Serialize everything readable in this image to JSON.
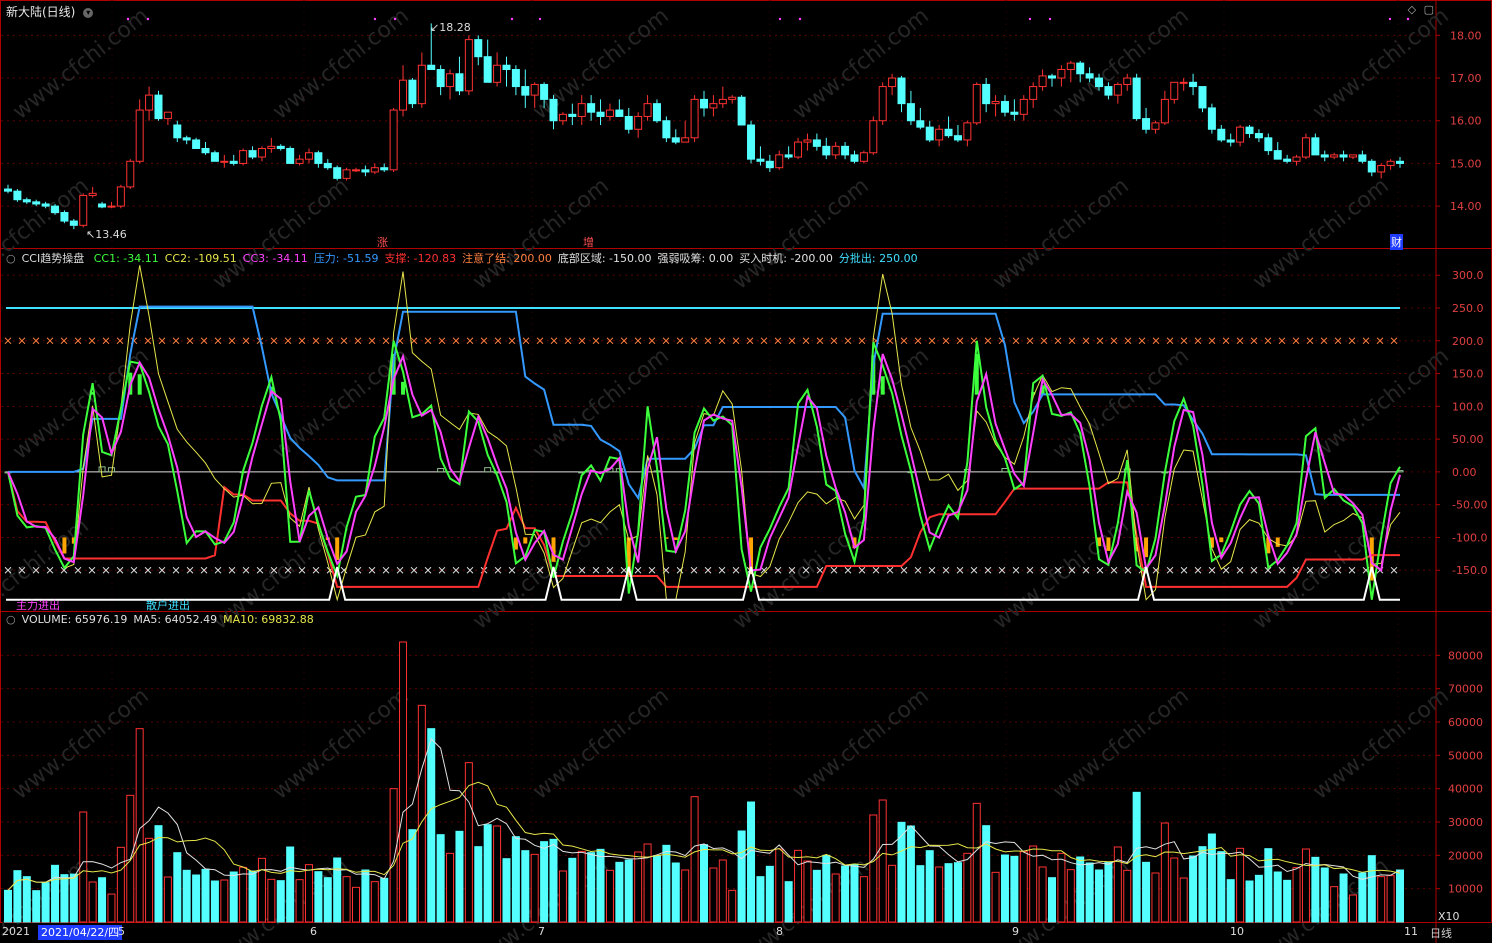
{
  "window": {
    "title": "新大陆(日线)",
    "corner_icons": [
      "diamond-icon",
      "window-icon"
    ]
  },
  "price_panel": {
    "y_ticks": [
      "18.00",
      "17.00",
      "16.00",
      "15.00",
      "14.00"
    ],
    "high_label": "18.28",
    "low_label": "13.46",
    "markers": [
      "涨",
      "增",
      "财"
    ]
  },
  "cci_panel": {
    "name": "CCI趋势操盘",
    "indicators": [
      {
        "label": "CC1: -34.11",
        "color": "#3cff3c"
      },
      {
        "label": "CC2: -109.51",
        "color": "#e6e64a"
      },
      {
        "label": "CC3: -34.11",
        "color": "#ff40ff"
      },
      {
        "label": "压力: -51.59",
        "color": "#3399ff"
      },
      {
        "label": "支撑: -120.83",
        "color": "#ff3030"
      },
      {
        "label": "注意了结: 200.00",
        "color": "#ff7f3f"
      },
      {
        "label": "底部区域: -150.00",
        "color": "#e0e0e0"
      },
      {
        "label": "强弱吸筹: 0.00",
        "color": "#e0e0e0"
      },
      {
        "label": "买入时机: -200.00",
        "color": "#e0e0e0"
      },
      {
        "label": "分批出: 250.00",
        "color": "#40e0ff"
      }
    ],
    "y_ticks": [
      "300.0",
      "250.0",
      "200.0",
      "150.0",
      "100.0",
      "50.00",
      "0.00",
      "-50.00",
      "-100.0",
      "-150.0"
    ],
    "signal_labels": [
      {
        "text": "主力进出",
        "color": "#ff40ff"
      },
      {
        "text": "散户进出",
        "color": "#40e0ff"
      }
    ]
  },
  "volume_panel": {
    "labels": [
      {
        "text": "VOLUME: 65976.19",
        "color": "#e0e0e0"
      },
      {
        "text": "MA5: 64052.49",
        "color": "#e0e0e0"
      },
      {
        "text": "MA10: 69832.88",
        "color": "#e6e64a"
      }
    ],
    "y_ticks": [
      "80000",
      "70000",
      "60000",
      "50000",
      "40000",
      "30000",
      "20000",
      "10000"
    ],
    "unit": "X10"
  },
  "x_axis": {
    "year_label": "2021",
    "cursor_date": "2021/04/22/四",
    "month_labels": [
      "5",
      "6",
      "7",
      "8",
      "9",
      "10",
      "11"
    ],
    "period": "日线"
  },
  "colors": {
    "up": "#ff3232",
    "down": "#54ffff",
    "frame": "#b00000",
    "grid": "#5a0000"
  },
  "chart_data": {
    "type": "candlestick",
    "ohlc": [
      [
        14.4,
        14.5,
        14.3,
        14.35
      ],
      [
        14.35,
        14.4,
        14.1,
        14.15
      ],
      [
        14.15,
        14.2,
        14.05,
        14.1
      ],
      [
        14.1,
        14.15,
        14.0,
        14.05
      ],
      [
        14.05,
        14.1,
        13.95,
        14.0
      ],
      [
        14.0,
        14.05,
        13.8,
        13.85
      ],
      [
        13.85,
        13.9,
        13.6,
        13.65
      ],
      [
        13.65,
        13.7,
        13.46,
        13.55
      ],
      [
        13.55,
        14.3,
        13.5,
        14.25
      ],
      [
        14.25,
        14.45,
        14.2,
        14.3
      ],
      [
        14.05,
        14.1,
        13.95,
        13.98
      ],
      [
        13.98,
        14.1,
        13.95,
        14.0
      ],
      [
        14.0,
        14.5,
        13.95,
        14.45
      ],
      [
        14.45,
        15.1,
        14.4,
        15.05
      ],
      [
        15.05,
        16.5,
        15.0,
        16.25
      ],
      [
        16.25,
        16.8,
        16.0,
        16.6
      ],
      [
        16.6,
        16.7,
        16.0,
        16.05
      ],
      [
        16.05,
        16.2,
        15.9,
        16.2
      ],
      [
        15.9,
        16.0,
        15.5,
        15.6
      ],
      [
        15.6,
        15.65,
        15.45,
        15.55
      ],
      [
        15.55,
        15.6,
        15.35,
        15.35
      ],
      [
        15.35,
        15.5,
        15.2,
        15.25
      ],
      [
        15.25,
        15.3,
        15.05,
        15.05
      ],
      [
        15.05,
        15.2,
        14.9,
        15.05
      ],
      [
        15.05,
        15.2,
        14.95,
        15.0
      ],
      [
        15.0,
        15.35,
        14.95,
        15.3
      ],
      [
        15.3,
        15.4,
        15.1,
        15.15
      ],
      [
        15.15,
        15.4,
        15.05,
        15.35
      ],
      [
        15.35,
        15.6,
        15.25,
        15.4
      ],
      [
        15.4,
        15.45,
        15.3,
        15.35
      ],
      [
        15.35,
        15.4,
        15.0,
        15.0
      ],
      [
        15.0,
        15.2,
        14.95,
        15.1
      ],
      [
        15.1,
        15.35,
        15.0,
        15.25
      ],
      [
        15.25,
        15.3,
        14.9,
        15.0
      ],
      [
        15.0,
        15.1,
        14.85,
        14.9
      ],
      [
        14.9,
        14.95,
        14.6,
        14.65
      ],
      [
        14.65,
        14.9,
        14.6,
        14.85
      ],
      [
        14.85,
        14.9,
        14.8,
        14.85
      ],
      [
        14.85,
        14.95,
        14.7,
        14.8
      ],
      [
        14.8,
        15.0,
        14.75,
        14.9
      ],
      [
        14.9,
        15.0,
        14.8,
        14.85
      ],
      [
        14.85,
        16.3,
        14.8,
        16.25
      ],
      [
        16.25,
        17.3,
        16.1,
        16.95
      ],
      [
        16.95,
        17.0,
        16.3,
        16.4
      ],
      [
        16.4,
        17.6,
        16.3,
        17.3
      ],
      [
        17.3,
        18.28,
        17.2,
        17.2
      ],
      [
        17.2,
        17.3,
        16.6,
        16.8
      ],
      [
        16.8,
        17.2,
        16.5,
        17.1
      ],
      [
        17.1,
        17.5,
        16.6,
        16.7
      ],
      [
        16.7,
        18.0,
        16.6,
        17.9
      ],
      [
        17.9,
        18.0,
        17.3,
        17.5
      ],
      [
        17.5,
        17.9,
        17.1,
        16.9
      ],
      [
        16.9,
        17.6,
        16.8,
        17.3
      ],
      [
        17.3,
        17.5,
        16.8,
        17.2
      ],
      [
        17.2,
        17.3,
        16.6,
        16.8
      ],
      [
        16.8,
        17.2,
        16.3,
        16.6
      ],
      [
        16.6,
        16.9,
        16.3,
        16.85
      ],
      [
        16.85,
        16.9,
        16.3,
        16.5
      ],
      [
        16.5,
        16.6,
        15.8,
        16.0
      ],
      [
        16.0,
        16.2,
        15.9,
        16.15
      ],
      [
        16.15,
        16.4,
        15.9,
        16.1
      ],
      [
        16.1,
        16.6,
        15.9,
        16.4
      ],
      [
        16.4,
        16.6,
        16.0,
        16.2
      ],
      [
        16.2,
        16.5,
        15.9,
        16.1
      ],
      [
        16.1,
        16.4,
        16.0,
        16.25
      ],
      [
        16.25,
        16.5,
        16.1,
        16.1
      ],
      [
        16.1,
        16.3,
        15.7,
        15.8
      ],
      [
        15.8,
        16.2,
        15.6,
        16.1
      ],
      [
        16.1,
        16.6,
        16.0,
        16.4
      ],
      [
        16.4,
        16.5,
        15.95,
        16.0
      ],
      [
        16.0,
        16.1,
        15.5,
        15.6
      ],
      [
        15.6,
        15.8,
        15.45,
        15.5
      ],
      [
        15.5,
        16.0,
        15.5,
        15.6
      ],
      [
        15.6,
        16.6,
        15.5,
        16.5
      ],
      [
        16.5,
        16.7,
        16.1,
        16.3
      ],
      [
        16.3,
        16.6,
        16.1,
        16.4
      ],
      [
        16.4,
        16.8,
        16.3,
        16.5
      ],
      [
        16.5,
        16.6,
        16.4,
        16.55
      ],
      [
        16.55,
        16.6,
        15.9,
        15.9
      ],
      [
        15.9,
        16.0,
        15.0,
        15.1
      ],
      [
        15.1,
        15.4,
        14.95,
        15.05
      ],
      [
        15.05,
        15.2,
        14.8,
        14.9
      ],
      [
        14.9,
        15.3,
        14.85,
        15.2
      ],
      [
        15.2,
        15.4,
        15.1,
        15.15
      ],
      [
        15.15,
        15.6,
        15.1,
        15.5
      ],
      [
        15.5,
        15.7,
        15.3,
        15.55
      ],
      [
        15.55,
        15.7,
        15.3,
        15.4
      ],
      [
        15.4,
        15.6,
        15.1,
        15.2
      ],
      [
        15.2,
        15.5,
        15.1,
        15.4
      ],
      [
        15.4,
        15.5,
        15.1,
        15.2
      ],
      [
        15.2,
        15.3,
        15.0,
        15.05
      ],
      [
        15.05,
        15.3,
        15.0,
        15.25
      ],
      [
        15.25,
        16.1,
        15.2,
        16.0
      ],
      [
        16.0,
        16.9,
        15.9,
        16.8
      ],
      [
        16.8,
        17.1,
        16.6,
        17.0
      ],
      [
        17.0,
        17.05,
        16.2,
        16.4
      ],
      [
        16.4,
        16.7,
        15.9,
        16.0
      ],
      [
        16.0,
        16.3,
        15.8,
        15.85
      ],
      [
        15.85,
        16.0,
        15.5,
        15.55
      ],
      [
        15.55,
        15.9,
        15.4,
        15.8
      ],
      [
        15.8,
        16.1,
        15.6,
        15.65
      ],
      [
        15.65,
        15.9,
        15.5,
        15.55
      ],
      [
        15.55,
        16.0,
        15.4,
        15.95
      ],
      [
        15.95,
        16.9,
        15.9,
        16.85
      ],
      [
        16.85,
        17.0,
        16.2,
        16.4
      ],
      [
        16.4,
        16.6,
        16.1,
        16.45
      ],
      [
        16.45,
        16.6,
        16.1,
        16.2
      ],
      [
        16.2,
        16.5,
        16.0,
        16.15
      ],
      [
        16.15,
        16.6,
        16.0,
        16.5
      ],
      [
        16.5,
        16.9,
        16.3,
        16.8
      ],
      [
        16.8,
        17.2,
        16.7,
        17.05
      ],
      [
        17.05,
        17.1,
        16.8,
        17.0
      ],
      [
        17.0,
        17.3,
        16.8,
        17.2
      ],
      [
        17.2,
        17.4,
        16.9,
        17.35
      ],
      [
        17.35,
        17.4,
        16.9,
        17.1
      ],
      [
        17.1,
        17.25,
        16.9,
        17.0
      ],
      [
        17.0,
        17.1,
        16.7,
        16.8
      ],
      [
        16.8,
        16.9,
        16.5,
        16.6
      ],
      [
        16.6,
        16.9,
        16.4,
        16.85
      ],
      [
        16.85,
        17.1,
        16.7,
        17.0
      ],
      [
        17.0,
        17.1,
        16.0,
        16.05
      ],
      [
        16.05,
        16.3,
        15.7,
        15.8
      ],
      [
        15.8,
        16.0,
        15.7,
        15.95
      ],
      [
        15.95,
        16.7,
        15.9,
        16.5
      ],
      [
        16.5,
        16.9,
        16.4,
        16.9
      ],
      [
        16.9,
        17.0,
        16.7,
        16.9
      ],
      [
        16.9,
        17.1,
        16.6,
        16.8
      ],
      [
        16.8,
        16.8,
        16.2,
        16.3
      ],
      [
        16.3,
        16.4,
        15.7,
        15.8
      ],
      [
        15.8,
        15.9,
        15.5,
        15.55
      ],
      [
        15.55,
        15.7,
        15.4,
        15.5
      ],
      [
        15.5,
        15.9,
        15.4,
        15.85
      ],
      [
        15.85,
        15.9,
        15.6,
        15.7
      ],
      [
        15.7,
        15.8,
        15.5,
        15.6
      ],
      [
        15.6,
        15.7,
        15.2,
        15.3
      ],
      [
        15.3,
        15.5,
        15.1,
        15.1
      ],
      [
        15.1,
        15.2,
        15.0,
        15.05
      ],
      [
        15.05,
        15.2,
        14.95,
        15.15
      ],
      [
        15.15,
        15.7,
        15.1,
        15.6
      ],
      [
        15.6,
        15.7,
        15.4,
        15.2
      ],
      [
        15.2,
        15.3,
        15.05,
        15.15
      ],
      [
        15.15,
        15.25,
        15.1,
        15.2
      ],
      [
        15.2,
        15.3,
        15.05,
        15.15
      ],
      [
        15.15,
        15.2,
        15.1,
        15.2
      ],
      [
        15.2,
        15.3,
        15.0,
        15.05
      ],
      [
        15.05,
        15.1,
        14.7,
        14.8
      ],
      [
        14.8,
        15.0,
        14.65,
        14.95
      ],
      [
        14.95,
        15.1,
        14.85,
        15.05
      ],
      [
        15.05,
        15.15,
        14.9,
        15.0
      ]
    ]
  }
}
